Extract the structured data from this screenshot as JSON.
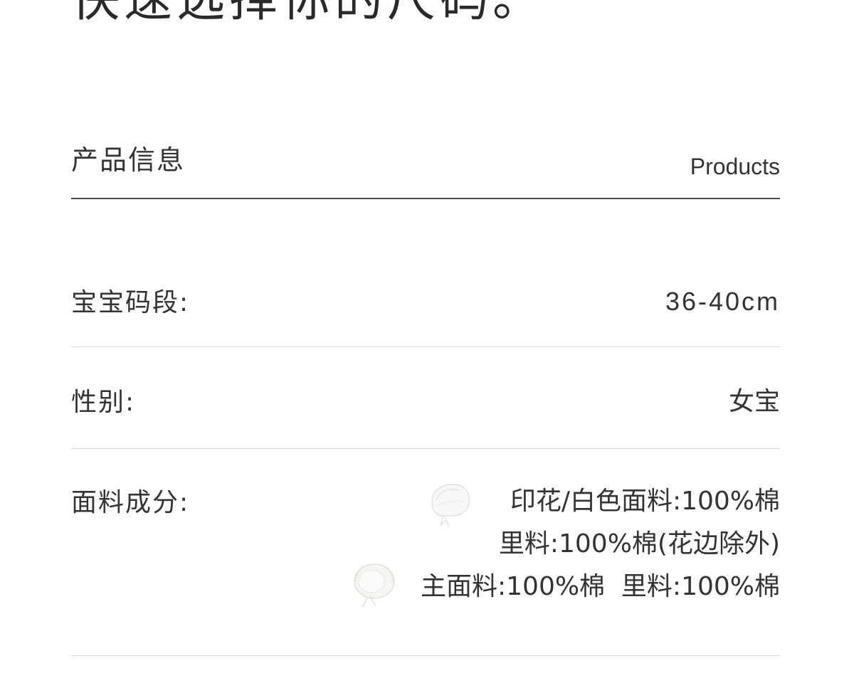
{
  "headline": "快速选择你的尺码。",
  "section": {
    "title": "产品信息",
    "title_en": "Products"
  },
  "rows": {
    "size": {
      "label": "宝宝码段:",
      "value": "36-40cm"
    },
    "gender": {
      "label": "性别:",
      "value": "女宝"
    },
    "fabric": {
      "label": "面料成分:",
      "lines": [
        "印花/白色面料:100%棉",
        "里料:100%棉(花边除外)",
        "主面料:100%棉  里料:100%棉"
      ],
      "thumbnails": [
        "white-bonnet-image",
        "lace-bonnet-image"
      ]
    }
  },
  "colors": {
    "text": "#333333",
    "divider_strong": "#4a4a4a",
    "divider_light": "#d9d9d9",
    "background": "#ffffff"
  }
}
